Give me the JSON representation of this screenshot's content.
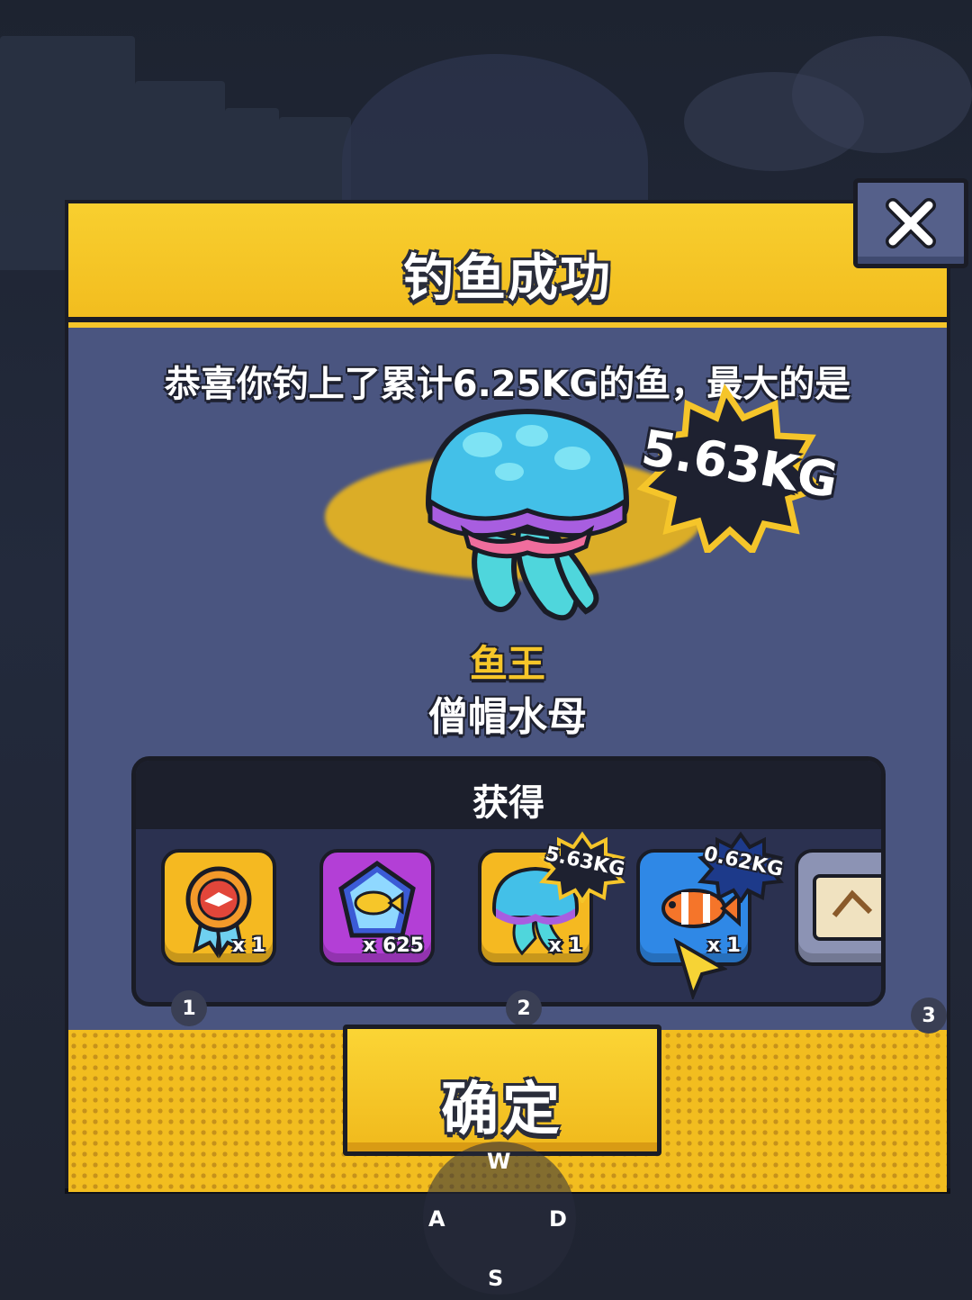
{
  "dialog": {
    "title": "钓鱼成功",
    "message": "恭喜你钓上了累计6.25KG的鱼，最大的是",
    "biggest_fish": {
      "weight": "5.63KG",
      "rank_label": "鱼王",
      "name": "僧帽水母"
    },
    "rewards": {
      "title": "获得",
      "items": [
        {
          "icon": "medal-icon",
          "count": "x 1",
          "color": "gold"
        },
        {
          "icon": "fish-gem-icon",
          "count": "x 625",
          "color": "purple"
        },
        {
          "icon": "jellyfish-icon",
          "count": "x 1",
          "badge": "5.63KG",
          "color": "gold"
        },
        {
          "icon": "clownfish-icon",
          "count": "x 1",
          "badge": "0.62KG",
          "color": "blue"
        },
        {
          "icon": "map-icon",
          "count": "",
          "color": "gray"
        }
      ]
    },
    "pages": [
      "1",
      "2",
      "3"
    ],
    "confirm_label": "确定"
  },
  "controls": {
    "keys": {
      "up": "W",
      "left": "A",
      "right": "D",
      "down": "S"
    }
  },
  "colors": {
    "frame_yellow": "#f5c52a",
    "panel_blue": "#4a5580",
    "badge_dark": "#1e2130",
    "badge_blue": "#1d3a8a"
  }
}
